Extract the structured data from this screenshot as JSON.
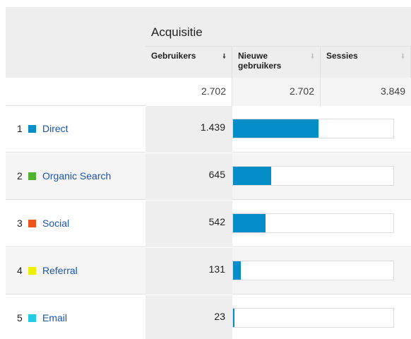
{
  "header": {
    "acquisition_title": "Acquisitie",
    "columns": [
      {
        "label": "Gebruikers",
        "sort_icon": "sort-arrow-down-icon",
        "active": true
      },
      {
        "label": "Nieuwe\ngebruikers",
        "sort_icon": "sort-arrow-down-icon",
        "active": false
      },
      {
        "label": "Sessies",
        "sort_icon": "sort-arrow-down-icon",
        "active": false
      }
    ]
  },
  "totals": {
    "users": "2.702",
    "new_users": "2.702",
    "sessions": "3.849"
  },
  "rows": [
    {
      "rank": "1",
      "source": "Direct",
      "color": "#058dc7",
      "users": "1.439",
      "share": 0.5326
    },
    {
      "rank": "2",
      "source": "Organic Search",
      "color": "#50b432",
      "users": "645",
      "share": 0.2387
    },
    {
      "rank": "3",
      "source": "Social",
      "color": "#ed561b",
      "users": "542",
      "share": 0.2006
    },
    {
      "rank": "4",
      "source": "Referral",
      "color": "#edef00",
      "users": "131",
      "share": 0.0485
    },
    {
      "rank": "5",
      "source": "Email",
      "color": "#24cbe5",
      "users": "23",
      "share": 0.0085
    }
  ],
  "colors": {
    "bar": "#058dc7",
    "link": "#1a55b2"
  }
}
